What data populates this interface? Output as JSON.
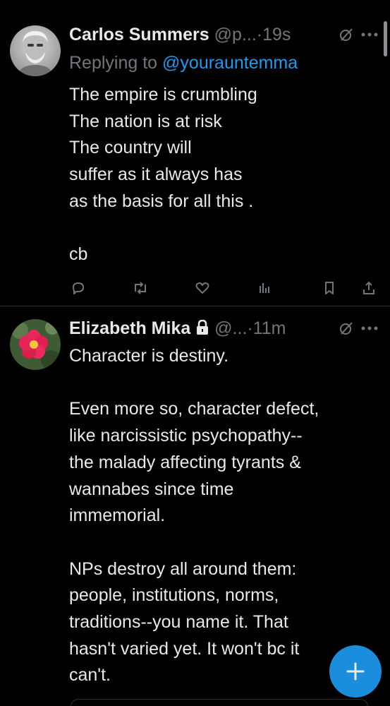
{
  "colors": {
    "background": "#000000",
    "text_primary": "#e7e9ea",
    "text_secondary": "#71767b",
    "accent": "#1d9bf0",
    "divider": "#2f3336"
  },
  "tweets": [
    {
      "display_name": "Carlos Summers",
      "handle": "@p...",
      "separator": "·",
      "time": "19s",
      "replying_prefix": "Replying to",
      "replying_to": "@yourauntemma",
      "text": "The empire is crumbling\nThe nation is at risk\nThe country will\nsuffer as it always has\nas the basis for all this .\n\ncb",
      "avatar_icon": "avatar-photo-grey-haired-man",
      "actions": [
        "reply-icon",
        "retweet-icon",
        "like-icon",
        "views-icon",
        "bookmark-icon",
        "share-icon"
      ]
    },
    {
      "display_name": "Elizabeth Mika",
      "protected_icon": "lock-icon",
      "handle": "@...",
      "separator": "·",
      "time": "11m",
      "text": "Character is destiny.\n\nEven more so, character defect,\nlike narcissistic psychopathy--\nthe malady affecting tyrants &\nwannabes since time\nimmemorial.\n\nNPs destroy all around them:\npeople, institutions, norms,\ntraditions--you name it. That\nhasn't varied yet. It won't bc it\ncan't.",
      "avatar_icon": "avatar-photo-red-rose"
    }
  ],
  "compose_button_icon": "plus-icon"
}
